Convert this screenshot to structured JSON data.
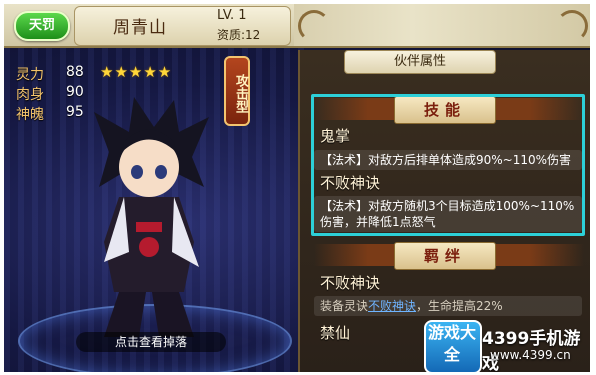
{
  "header": {
    "badge": "天罚",
    "hero_name": "周青山",
    "level": "LV. 1",
    "aptitude": "资质:12"
  },
  "stats": [
    {
      "label": "灵力",
      "value": "88"
    },
    {
      "label": "肉身",
      "value": "90"
    },
    {
      "label": "神魄",
      "value": "95"
    }
  ],
  "star_rating": {
    "stars": 5,
    "max": 5,
    "glyphs": "★★★★★"
  },
  "type_tag": "攻击型",
  "drop_button": "点击查看掉落",
  "panel": {
    "tab": "伙伴属性",
    "skills_header": "技能",
    "skills": [
      {
        "name": "鬼掌",
        "desc": "【法术】对敌方后排单体造成90%~110%伤害"
      },
      {
        "name": "不败神诀",
        "desc": "【法术】对敌方随机3个目标造成100%~110%伤害，并降低1点怒气"
      }
    ],
    "bonds_header": "羁绊",
    "bonds": [
      {
        "name": "不败神诀",
        "desc_prefix": "装备灵诀",
        "desc_link": "不败神诀",
        "desc_suffix": "，生命提高22%"
      },
      {
        "name": "禁仙"
      }
    ]
  },
  "watermark": {
    "logo_text": "游戏大全",
    "brand": "4399手机游戏",
    "url": "www.4399.cn",
    "colors": {
      "logo_blue": "#1f8fe0"
    }
  },
  "colors": {
    "highlight_border": "#2dd0d8",
    "stat_label": "#f2c36b",
    "star": "#ffd63a",
    "badge_green": "#2fae28"
  }
}
